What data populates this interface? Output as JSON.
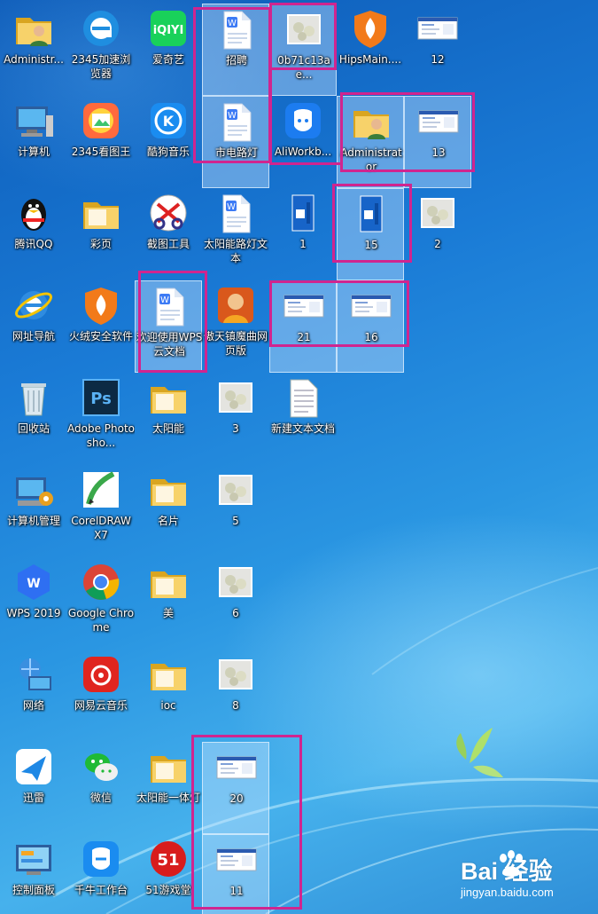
{
  "desktop": {
    "icons": [
      {
        "label": "Administr...",
        "icon": "user-folder-icon",
        "selected": false
      },
      {
        "label": "2345加速浏览器",
        "icon": "browser-2345-icon",
        "selected": false
      },
      {
        "label": "爱奇艺",
        "icon": "iqiyi-icon",
        "selected": false
      },
      {
        "label": "招聘",
        "icon": "wps-document-icon",
        "selected": true
      },
      {
        "label": "0b71c13ae...",
        "icon": "image-thumbnail-icon",
        "selected": true
      },
      {
        "label": "HipsMain....",
        "icon": "huorong-shield-icon",
        "selected": false
      },
      {
        "label": "12",
        "icon": "screenshot-thumbnail-icon",
        "selected": false
      },
      {
        "label": "计算机",
        "icon": "computer-icon",
        "selected": false
      },
      {
        "label": "2345看图王",
        "icon": "image-viewer-2345-icon",
        "selected": false
      },
      {
        "label": "酷狗音乐",
        "icon": "kugou-icon",
        "selected": false
      },
      {
        "label": "市电路灯",
        "icon": "wps-document-icon",
        "selected": true
      },
      {
        "label": "AliWorkb...",
        "icon": "aliworkbench-icon",
        "selected": false
      },
      {
        "label": "Administrator",
        "icon": "user-folder-icon",
        "selected": true
      },
      {
        "label": "13",
        "icon": "screenshot-thumbnail-icon",
        "selected": true
      },
      {
        "label": "腾讯QQ",
        "icon": "qq-penguin-icon",
        "selected": false
      },
      {
        "label": "彩页",
        "icon": "folder-icon",
        "selected": false
      },
      {
        "label": "截图工具",
        "icon": "snipping-tool-icon",
        "selected": false
      },
      {
        "label": "太阳能路灯文本",
        "icon": "wps-document-icon",
        "selected": false
      },
      {
        "label": "1",
        "icon": "blue-image-thumbnail-icon",
        "selected": false
      },
      {
        "label": "15",
        "icon": "blue-image-thumbnail-icon",
        "selected": true
      },
      {
        "label": "2",
        "icon": "image-thumbnail-icon",
        "selected": false
      },
      {
        "label": "网址导航",
        "icon": "ie-icon",
        "selected": false
      },
      {
        "label": "火绒安全软件",
        "icon": "huorong-shield-icon",
        "selected": false
      },
      {
        "label": "欢迎使用WPS云文档",
        "icon": "wps-document-icon",
        "selected": true
      },
      {
        "label": "傲天镇魔曲网页版",
        "icon": "game-character-icon",
        "selected": false
      },
      {
        "label": "21",
        "icon": "screenshot-thumbnail-icon",
        "selected": true
      },
      {
        "label": "16",
        "icon": "screenshot-thumbnail-icon",
        "selected": true
      },
      {
        "label": "回收站",
        "icon": "recycle-bin-icon",
        "selected": false
      },
      {
        "label": "Adobe Photosho...",
        "icon": "photoshop-icon",
        "selected": false
      },
      {
        "label": "太阳能",
        "icon": "folder-icon",
        "selected": false
      },
      {
        "label": "3",
        "icon": "image-thumbnail-icon",
        "selected": false
      },
      {
        "label": "新建文本文档",
        "icon": "text-file-icon",
        "selected": false
      },
      {
        "label": "计算机管理",
        "icon": "computer-management-icon",
        "selected": false
      },
      {
        "label": "CorelDRAW X7",
        "icon": "coreldraw-icon",
        "selected": false
      },
      {
        "label": "名片",
        "icon": "folder-icon",
        "selected": false
      },
      {
        "label": "5",
        "icon": "image-thumbnail-icon",
        "selected": false
      },
      {
        "label": "WPS 2019",
        "icon": "wps-2019-icon",
        "selected": false
      },
      {
        "label": "Google Chrome",
        "icon": "chrome-icon",
        "selected": false
      },
      {
        "label": "美",
        "icon": "folder-icon",
        "selected": false
      },
      {
        "label": "6",
        "icon": "image-thumbnail-icon",
        "selected": false
      },
      {
        "label": "网络",
        "icon": "network-icon",
        "selected": false
      },
      {
        "label": "网易云音乐",
        "icon": "netease-music-icon",
        "selected": false
      },
      {
        "label": "ioc",
        "icon": "folder-icon",
        "selected": false
      },
      {
        "label": "8",
        "icon": "image-thumbnail-icon",
        "selected": false
      },
      {
        "label": "迅雷",
        "icon": "xunlei-bird-icon",
        "selected": false
      },
      {
        "label": "微信",
        "icon": "wechat-icon",
        "selected": false
      },
      {
        "label": "太阳能一体灯",
        "icon": "folder-icon",
        "selected": false
      },
      {
        "label": "20",
        "icon": "screenshot-thumbnail-icon",
        "selected": true
      },
      {
        "label": "控制面板",
        "icon": "control-panel-icon",
        "selected": false
      },
      {
        "label": "千牛工作台",
        "icon": "qianniu-icon",
        "selected": false
      },
      {
        "label": "51游戏堂",
        "icon": "game-51-icon",
        "selected": false
      },
      {
        "label": "11",
        "icon": "screenshot-thumbnail-icon",
        "selected": true
      }
    ],
    "highlight_color": "#d0258f"
  },
  "watermark": {
    "logo": "Bai  经验",
    "url": "jingyan.baidu.com"
  }
}
